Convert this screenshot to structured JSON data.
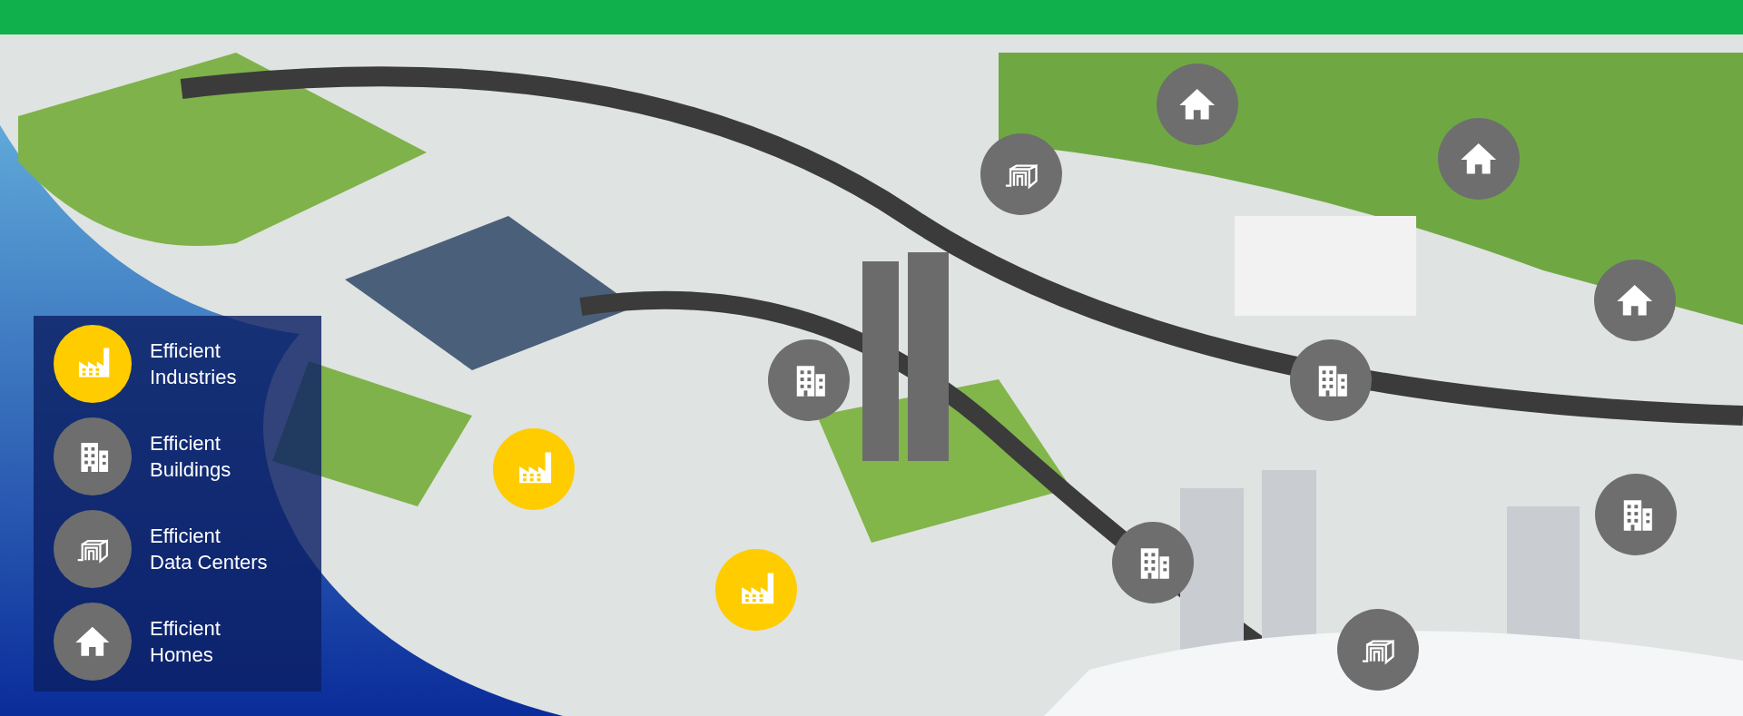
{
  "legend": [
    {
      "kind": "industry",
      "label": "Efficient\nIndustries"
    },
    {
      "kind": "building",
      "label": "Efficient\nBuildings"
    },
    {
      "kind": "datacenter",
      "label": "Efficient\nData Centers"
    },
    {
      "kind": "home",
      "label": "Efficient\nHomes"
    }
  ],
  "map_markers": [
    {
      "kind": "home"
    },
    {
      "kind": "datacenter"
    },
    {
      "kind": "home"
    },
    {
      "kind": "home"
    },
    {
      "kind": "building"
    },
    {
      "kind": "building"
    },
    {
      "kind": "industry"
    },
    {
      "kind": "building"
    },
    {
      "kind": "building"
    },
    {
      "kind": "industry"
    },
    {
      "kind": "datacenter"
    }
  ]
}
